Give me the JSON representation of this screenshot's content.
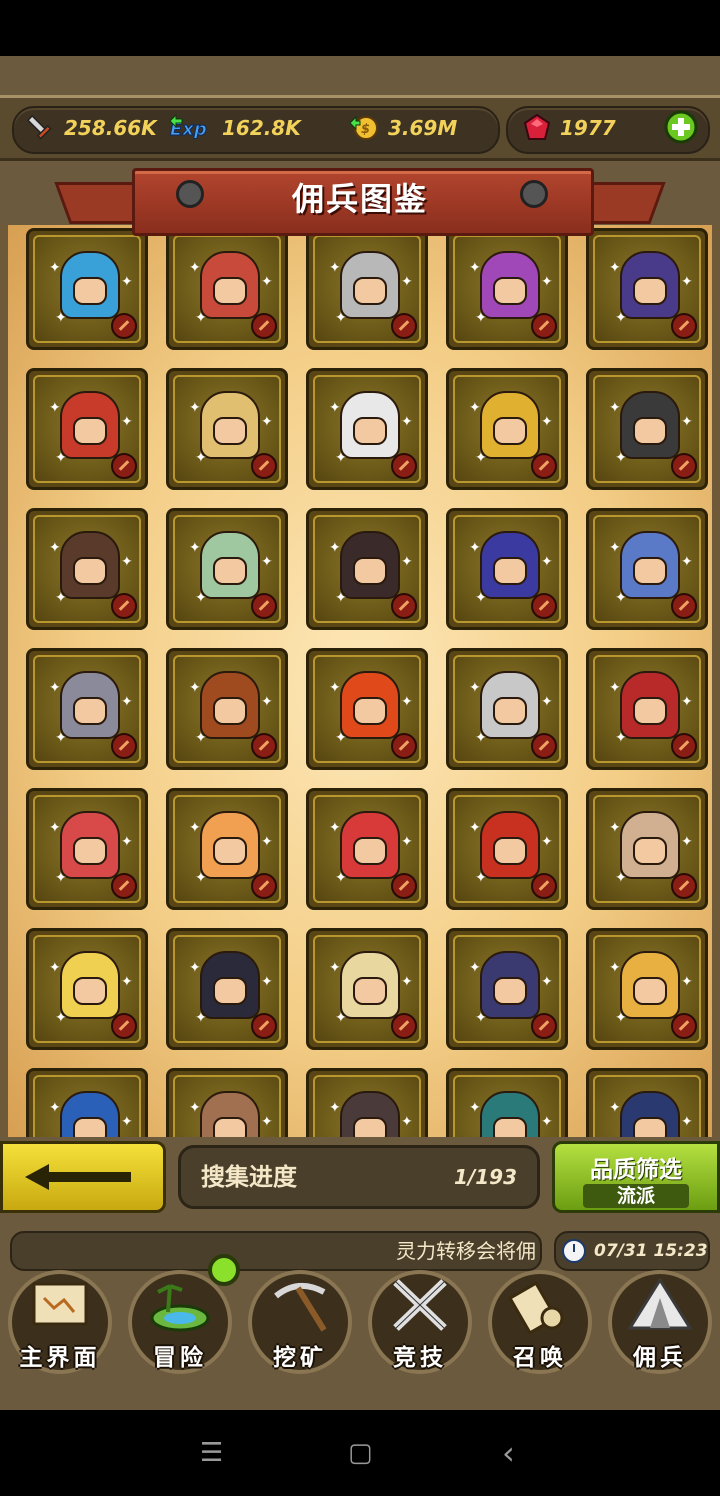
{
  "resources": {
    "attack": "258.66K",
    "exp": "162.8K",
    "gold": "3.69M",
    "gems": "1977",
    "attack_icon": "sword-icon",
    "exp_icon": "exp-icon",
    "gold_icon": "gold-coin-icon",
    "gem_icon": "ruby-icon",
    "add_icon": "plus-icon"
  },
  "banner": {
    "title": "佣兵图鉴"
  },
  "cards": [
    {
      "color": "#3aa0d8"
    },
    {
      "color": "#c84a3a"
    },
    {
      "color": "#b8b8b8"
    },
    {
      "color": "#a048b8"
    },
    {
      "color": "#4a3a8a"
    },
    {
      "color": "#c83a2a"
    },
    {
      "color": "#e0c070"
    },
    {
      "color": "#e8e8e8"
    },
    {
      "color": "#e0b030"
    },
    {
      "color": "#3a3a3a"
    },
    {
      "color": "#5a3a2a"
    },
    {
      "color": "#a0c8a0"
    },
    {
      "color": "#3a2a2a"
    },
    {
      "color": "#3a3aa0"
    },
    {
      "color": "#5a7ac8"
    },
    {
      "color": "#8a8a9a"
    },
    {
      "color": "#a04a20"
    },
    {
      "color": "#e04a1a"
    },
    {
      "color": "#c8c8c8"
    },
    {
      "color": "#b82a2a"
    },
    {
      "color": "#d84a4a"
    },
    {
      "color": "#f0a050"
    },
    {
      "color": "#d83a3a"
    },
    {
      "color": "#c83020"
    },
    {
      "color": "#d0b090"
    },
    {
      "color": "#f0d050"
    },
    {
      "color": "#2a2a3a"
    },
    {
      "color": "#e8d8a0"
    },
    {
      "color": "#3a3a70"
    },
    {
      "color": "#e8b040"
    },
    {
      "color": "#2a60b8"
    },
    {
      "color": "#a07050"
    },
    {
      "color": "#4a3a3a"
    },
    {
      "color": "#2a7a7a"
    },
    {
      "color": "#2a3a70"
    }
  ],
  "back": {
    "icon": "arrow-left-icon"
  },
  "progress": {
    "label": "搜集进度",
    "value": "1/193"
  },
  "filter": {
    "title": "品质筛选",
    "subtitle": "流派"
  },
  "notice": {
    "text": "灵力转移会将佣"
  },
  "clock": {
    "value": "07/31 15:23",
    "icon": "clock-icon"
  },
  "nav": [
    {
      "label": "主界面",
      "icon": "map-scroll-icon"
    },
    {
      "label": "冒险",
      "icon": "island-icon"
    },
    {
      "label": "挖矿",
      "icon": "pickaxe-icon"
    },
    {
      "label": "竞技",
      "icon": "crossed-swords-icon"
    },
    {
      "label": "召唤",
      "icon": "summon-scroll-icon"
    },
    {
      "label": "佣兵",
      "icon": "tent-icon"
    }
  ],
  "system_nav": {
    "menu": "☰",
    "home": "▢",
    "back": "‹"
  }
}
